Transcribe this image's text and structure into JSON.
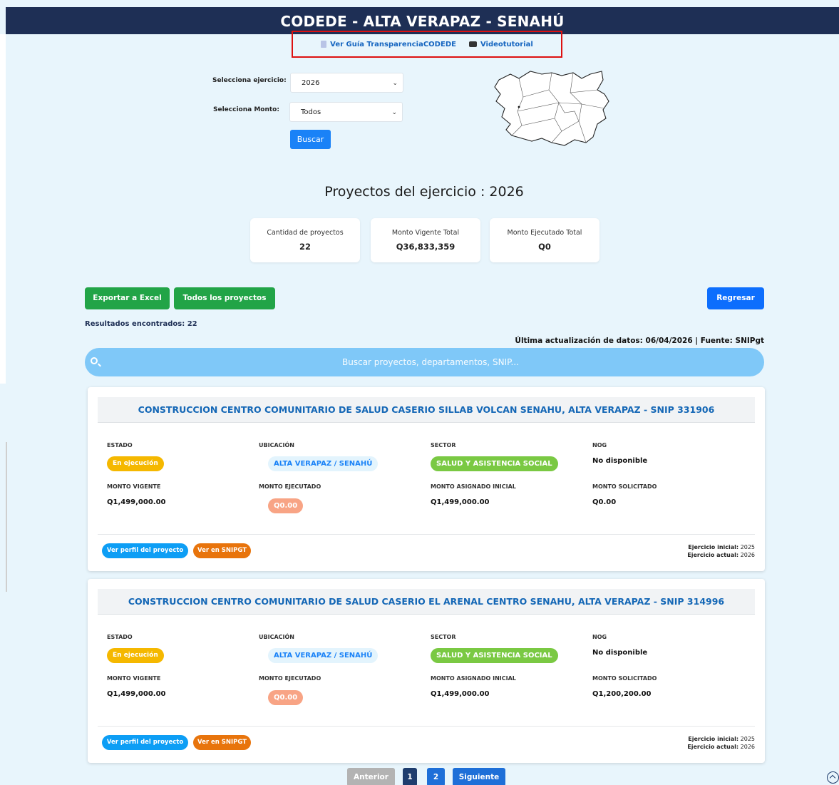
{
  "header": {
    "title": "CODEDE - ALTA VERAPAZ - SENAHÚ"
  },
  "links": {
    "guide": "Ver Guía TransparenciaCODEDE",
    "video": "Videotutorial"
  },
  "filters": {
    "ejercicio_label": "Selecciona ejercicio:",
    "ejercicio_value": "2026",
    "monto_label": "Selecciona Monto:",
    "monto_value": "Todos",
    "search_button": "Buscar"
  },
  "section_title": "Proyectos del ejercicio : 2026",
  "stats": [
    {
      "label": "Cantidad de proyectos",
      "value": "22"
    },
    {
      "label": "Monto Vigente Total",
      "value": "Q36,833,359"
    },
    {
      "label": "Monto Ejecutado Total",
      "value": "Q0"
    }
  ],
  "actions": {
    "export": "Exportar a Excel",
    "all": "Todos los proyectos",
    "back": "Regresar"
  },
  "results_text": "Resultados encontrados: 22",
  "update_text": "Última actualización de datos: 06/04/2026 | Fuente: SNIPgt",
  "search": {
    "placeholder": "Buscar proyectos, departamentos, SNIP..."
  },
  "field_labels": {
    "estado": "ESTADO",
    "ubicacion": "UBICACIÓN",
    "sector": "SECTOR",
    "nog": "NOG",
    "monto_vigente": "MONTO VIGENTE",
    "monto_ejecutado": "MONTO EJECUTADO",
    "monto_asignado": "MONTO ASIGNADO INICIAL",
    "monto_solicitado": "MONTO SOLICITADO",
    "perfil_button": "Ver perfil del proyecto",
    "snip_button": "Ver en SNIPGT",
    "ejercicio_inicial": "Ejercicio inicial:",
    "ejercicio_actual": "Ejercicio actual:"
  },
  "projects": [
    {
      "title": "CONSTRUCCION CENTRO COMUNITARIO DE SALUD CASERIO SILLAB VOLCAN SENAHU, ALTA VERAPAZ - SNIP 331906",
      "estado": "En ejecución",
      "ubicacion": "ALTA VERAPAZ / SENAHÚ",
      "sector": "SALUD Y ASISTENCIA SOCIAL",
      "nog": "No disponible",
      "monto_vigente": "Q1,499,000.00",
      "monto_ejecutado": "Q0.00",
      "monto_asignado": "Q1,499,000.00",
      "monto_solicitado": "Q0.00",
      "ejercicio_inicial": "2025",
      "ejercicio_actual": "2026"
    },
    {
      "title": "CONSTRUCCION CENTRO COMUNITARIO DE SALUD CASERIO EL ARENAL CENTRO SENAHU, ALTA VERAPAZ - SNIP 314996",
      "estado": "En ejecución",
      "ubicacion": "ALTA VERAPAZ / SENAHÚ",
      "sector": "SALUD Y ASISTENCIA SOCIAL",
      "nog": "No disponible",
      "monto_vigente": "Q1,499,000.00",
      "monto_ejecutado": "Q0.00",
      "monto_asignado": "Q1,499,000.00",
      "monto_solicitado": "Q1,200,200.00",
      "ejercicio_inicial": "2025",
      "ejercicio_actual": "2026"
    }
  ],
  "pagination": {
    "prev": "Anterior",
    "pages": [
      "1",
      "2"
    ],
    "next": "Siguiente"
  }
}
